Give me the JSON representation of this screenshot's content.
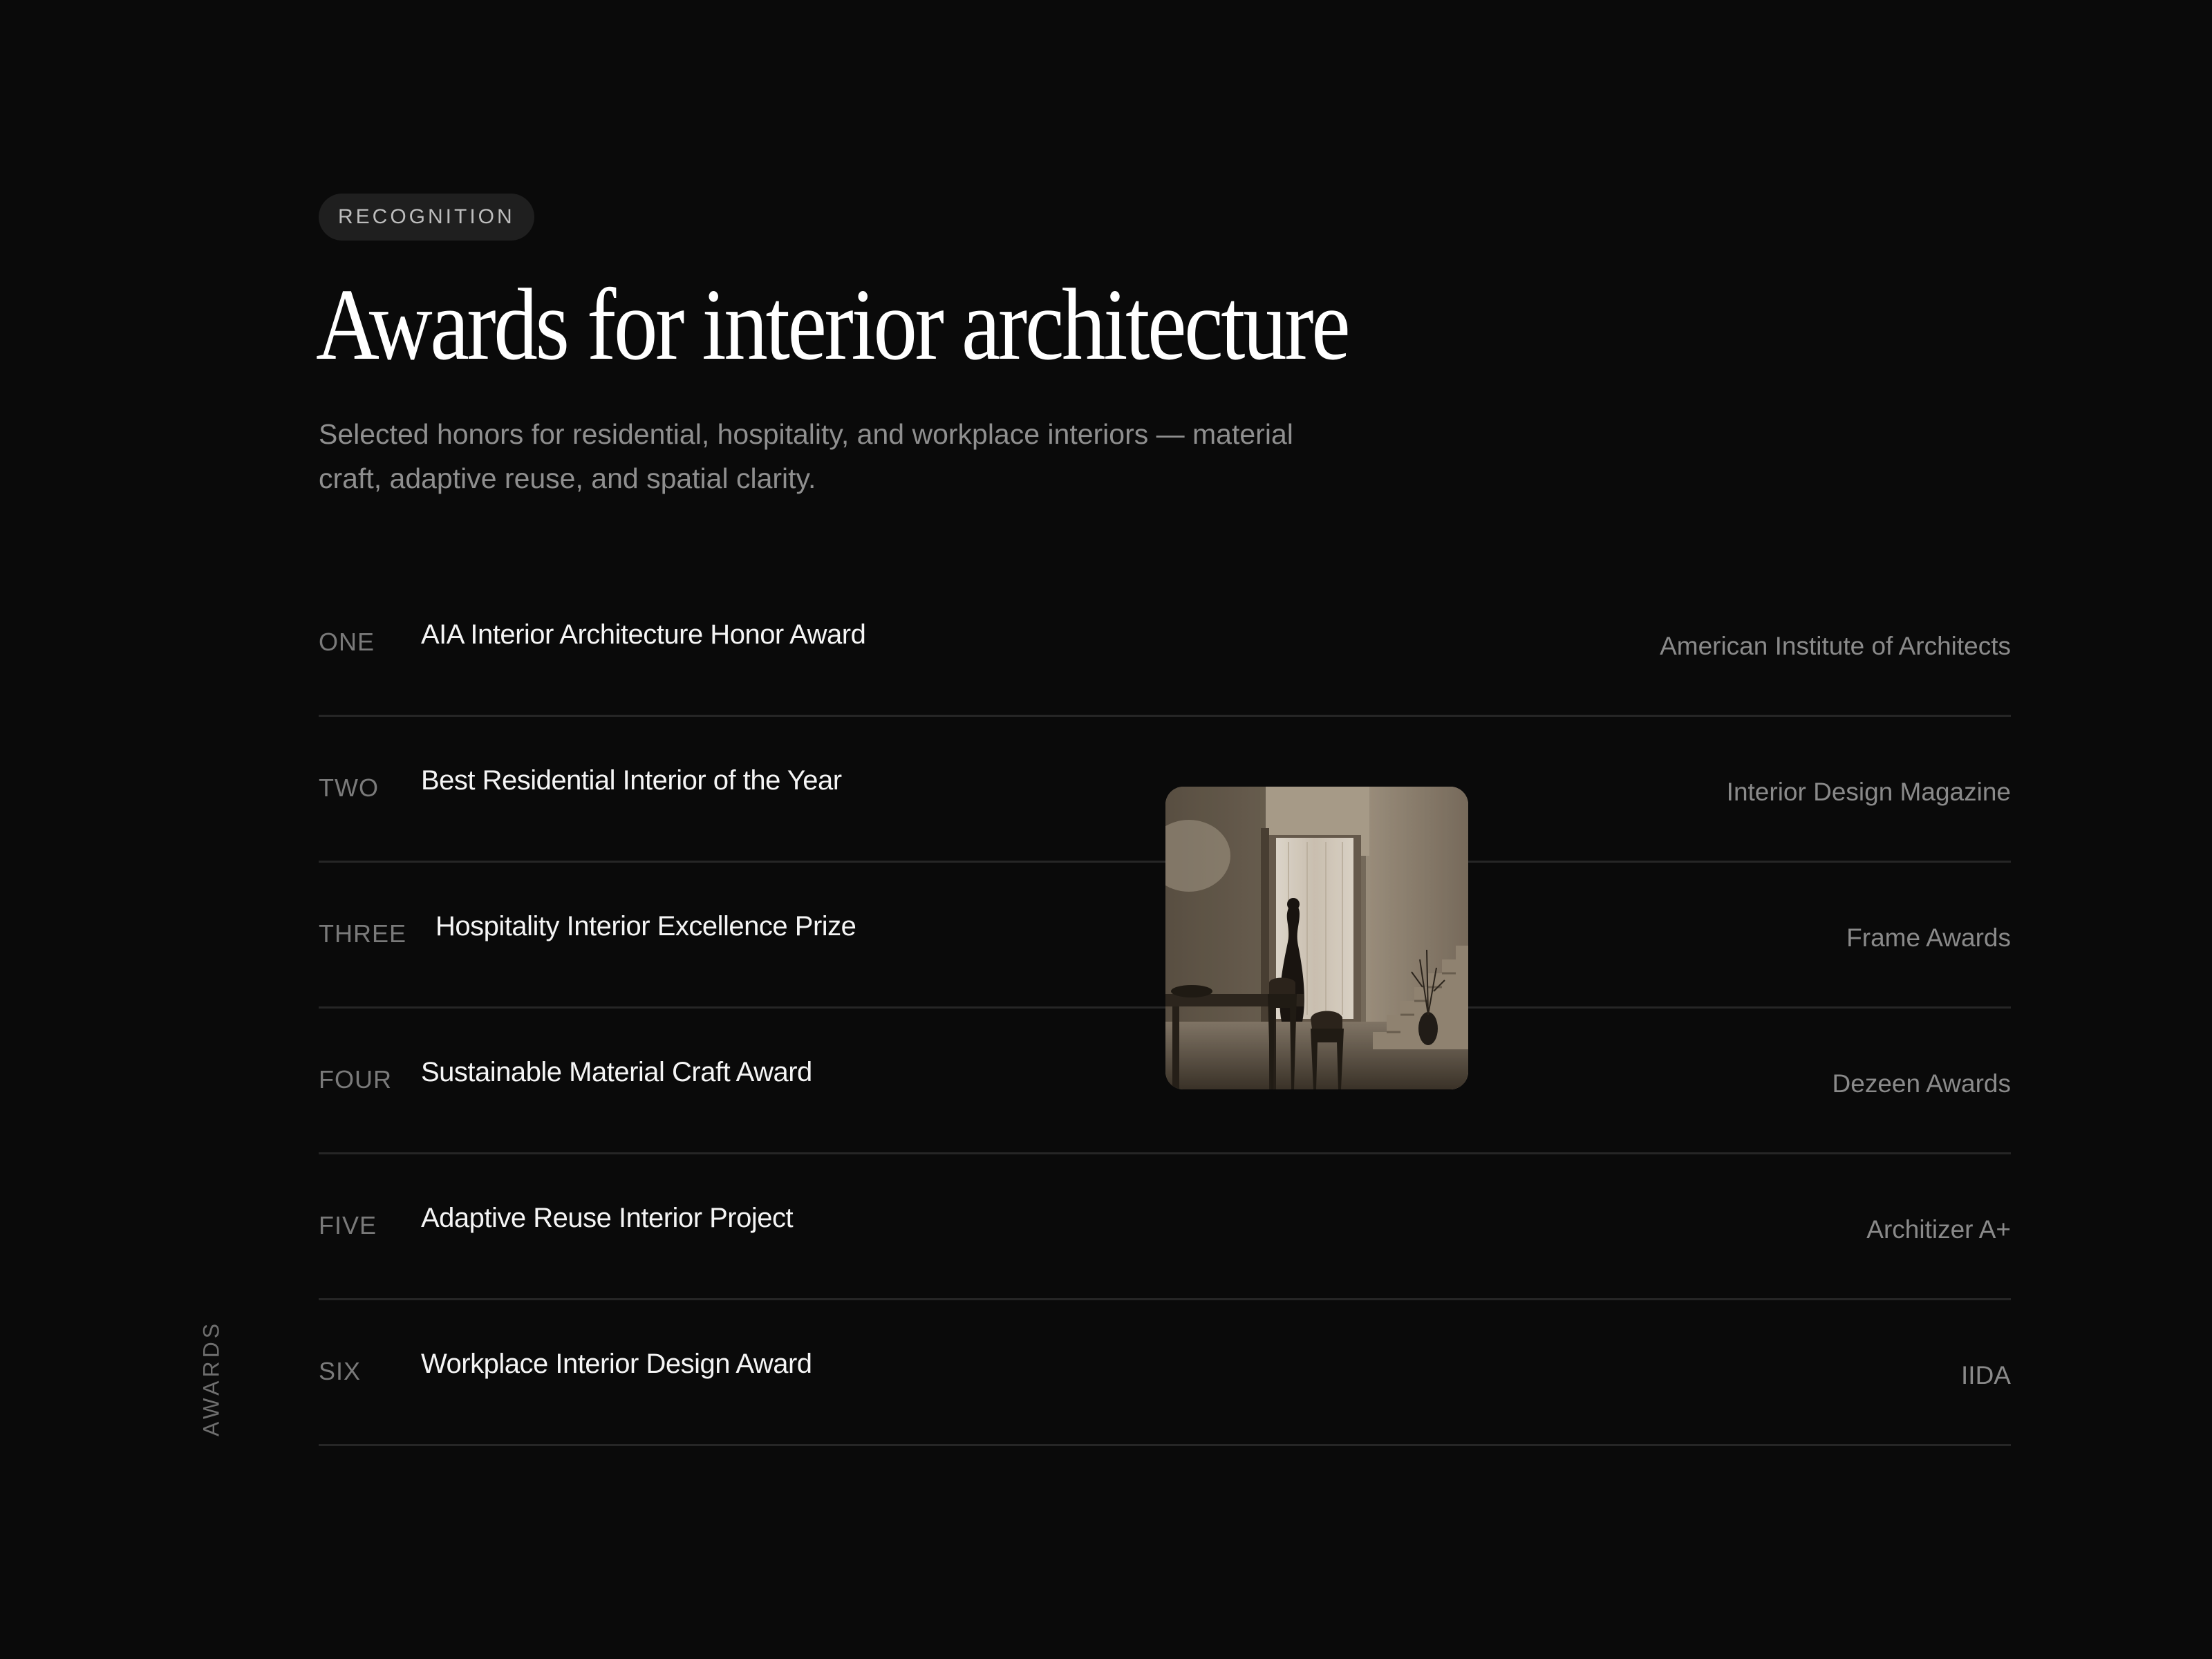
{
  "section": {
    "badge": "RECOGNITION",
    "title": "Awards for interior architecture",
    "subtitle": "Selected honors for residential, hospitality, and workplace interiors — material craft, adaptive reuse, and spatial clarity.",
    "side_label": "AWARDS"
  },
  "awards": [
    {
      "number": "ONE",
      "name": "AIA Interior Architecture Honor Award",
      "organization": "American Institute of Architects"
    },
    {
      "number": "TWO",
      "name": "Best Residential Interior of the Year",
      "organization": "Interior Design Magazine"
    },
    {
      "number": "THREE",
      "name": "Hospitality Interior Excellence Prize",
      "organization": "Frame Awards"
    },
    {
      "number": "FOUR",
      "name": "Sustainable Material Craft Award",
      "organization": "Dezeen Awards"
    },
    {
      "number": "FIVE",
      "name": "Adaptive Reuse Interior Project",
      "organization": "Architizer A+"
    },
    {
      "number": "SIX",
      "name": "Workplace Interior Design Award",
      "organization": "IIDA"
    }
  ],
  "colors": {
    "background": "#0a0a0a",
    "heading": "#ffffff",
    "muted_text": "#8f8f8f",
    "divider": "#262626",
    "badge_background": "#1f1f1f"
  }
}
